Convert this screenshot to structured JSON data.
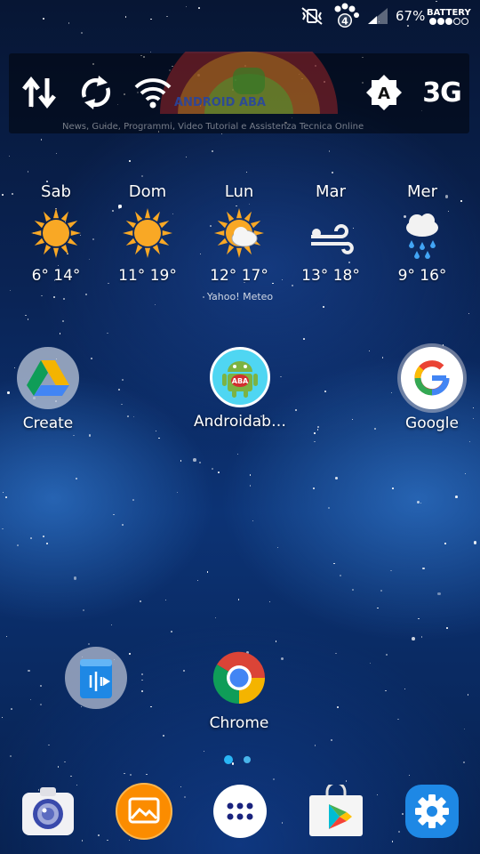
{
  "status_bar": {
    "battery_percent": "67%",
    "battery_label": "BATTERY",
    "notification_count": "4",
    "icons": [
      "mute-vibrate-icon",
      "paw-notification-icon",
      "signal-icon",
      "battery-dots-icon"
    ]
  },
  "toggles": {
    "items": [
      {
        "name": "data-transfer-toggle",
        "icon": "up-down-arrows-icon"
      },
      {
        "name": "auto-sync-toggle",
        "icon": "sync-icon"
      },
      {
        "name": "wifi-toggle",
        "icon": "wifi-icon"
      },
      {
        "name": "auto-brightness-toggle",
        "label": "A"
      },
      {
        "name": "network-mode-toggle",
        "label": "3G"
      }
    ],
    "watermark": {
      "name": "ANDROID ABA",
      "tagline": "News, Guide, Programmi, Video Tutorial e Assistenza Tecnica Online"
    }
  },
  "weather": {
    "source": "Yahoo! Meteo",
    "days": [
      {
        "day": "Sab",
        "temps": "6° 14°",
        "condition": "sunny"
      },
      {
        "day": "Dom",
        "temps": "11° 19°",
        "condition": "sunny"
      },
      {
        "day": "Lun",
        "temps": "12° 17°",
        "condition": "partly-cloudy"
      },
      {
        "day": "Mar",
        "temps": "13° 18°",
        "condition": "windy"
      },
      {
        "day": "Mer",
        "temps": "9° 16°",
        "condition": "rain"
      }
    ]
  },
  "apps": {
    "create": "Create",
    "androidaba": "Androidab…",
    "androidaba_badge": "ABA",
    "google": "Google",
    "chrome": "Chrome"
  },
  "pager": {
    "pages": 2,
    "current": 1
  },
  "dock": {
    "icons": [
      "camera-icon",
      "gallery-icon",
      "app-drawer-icon",
      "play-store-icon",
      "settings-icon"
    ]
  },
  "colors": {
    "accent_blue": "#29b6f6",
    "sun_orange": "#f9a825",
    "settings_blue": "#1e88e5"
  }
}
